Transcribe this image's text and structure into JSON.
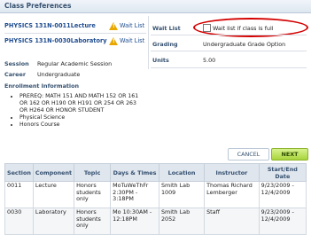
{
  "header": {
    "title": "Class Preferences"
  },
  "courses": [
    {
      "title": "PHYSICS 131N-0011Lecture",
      "wait_label": "Wait List"
    },
    {
      "title": "PHYSICS 131N-0030Laboratory",
      "wait_label": "Wait List"
    }
  ],
  "prefs": {
    "wait_list_label": "Wait List",
    "wait_list_option": "Wait list if class is full",
    "grading_label": "Grading",
    "grading_value": "Undergraduate Grade Option",
    "units_label": "Units",
    "units_value": "5.00"
  },
  "session": {
    "label": "Session",
    "value": "Regular Academic Session"
  },
  "career": {
    "label": "Career",
    "value": "Undergraduate"
  },
  "enrollment_info": {
    "label": "Enrollment Information",
    "items": [
      "PREREQ: MATH 151 AND MATH 152 OR 161 OR 162 OR H190 OR H191 OR 254 OR 263 OR H264 OR HONOR STUDENT",
      "Physical Science",
      "Honors Course"
    ]
  },
  "buttons": {
    "cancel": "CANCEL",
    "next": "NEXT"
  },
  "sections_table": {
    "headers": [
      "Section",
      "Component",
      "Topic",
      "Days & Times",
      "Location",
      "Instructor",
      "Start/End Date"
    ],
    "rows": [
      [
        "0011",
        "Lecture",
        "Honors students only",
        "MoTuWeThFr 2:30PM - 3:18PM",
        "Smith Lab 1009",
        "Thomas Richard Lemberger",
        "9/23/2009 - 12/4/2009"
      ],
      [
        "0030",
        "Laboratory",
        "Honors students only",
        "Mo 10:30AM - 12:18PM",
        "Smith Lab 2052",
        "Staff",
        "9/23/2009 - 12/4/2009"
      ]
    ]
  }
}
